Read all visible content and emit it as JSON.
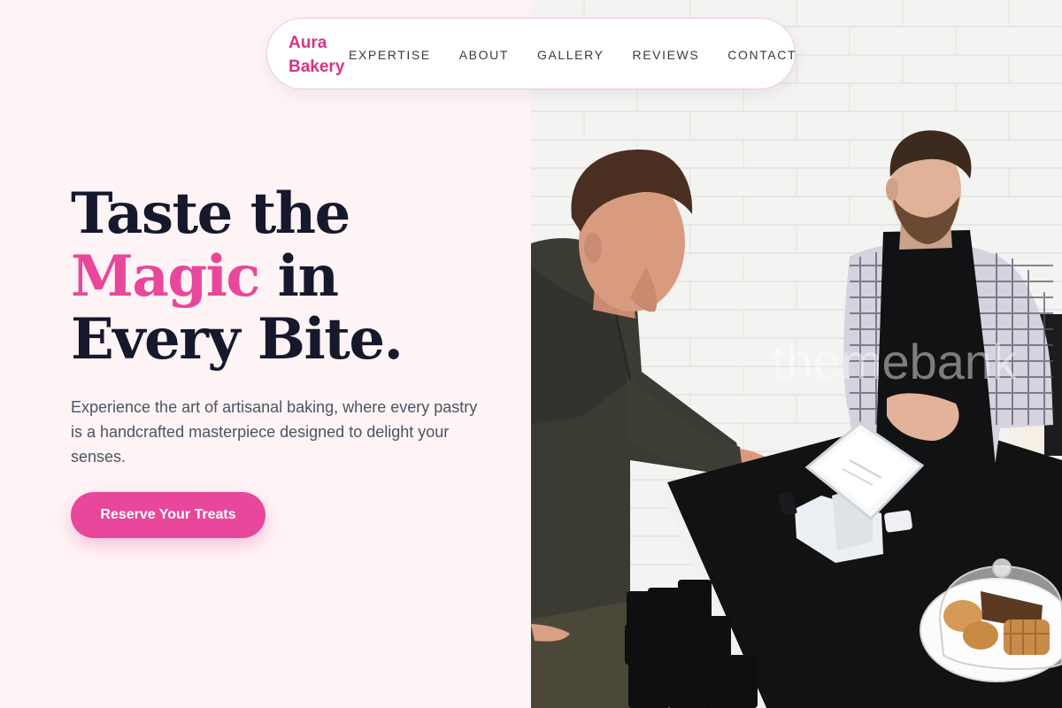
{
  "brand": {
    "name_line1": "Aura",
    "name_line2": "Bakery"
  },
  "nav": {
    "items": [
      {
        "label": "EXPERTISE"
      },
      {
        "label": "ABOUT"
      },
      {
        "label": "GALLERY"
      },
      {
        "label": "REVIEWS"
      },
      {
        "label": "CONTACT"
      }
    ]
  },
  "hero": {
    "headline_line1": "Taste the",
    "headline_accent": "Magic",
    "headline_line2_rest": " in",
    "headline_line3": "Every Bite.",
    "subtext": "Experience the art of artisanal baking, where every pastry is a handcrafted masterpiece designed to delight your senses.",
    "cta_label": "Reserve Your Treats"
  },
  "photo": {
    "watermark": "themebank"
  },
  "colors": {
    "accent": "#e8479b",
    "brand": "#d63384",
    "heading": "#16182b",
    "background": "#fef3f5"
  }
}
